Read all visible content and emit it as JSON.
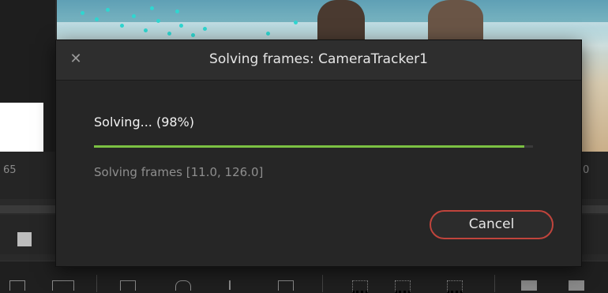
{
  "dialog": {
    "title": "Solving frames: CameraTracker1",
    "close_icon": "close-icon",
    "status": "Solving... (98%)",
    "progress": 0.98,
    "detail": "Solving frames [11.0, 126.0]",
    "cancel_label": "Cancel",
    "accent_color": "#7bc043",
    "cancel_border_color": "#c0443c"
  },
  "background": {
    "frame_left": "65",
    "frame_right": "0",
    "stop_icon": "stop-icon"
  }
}
